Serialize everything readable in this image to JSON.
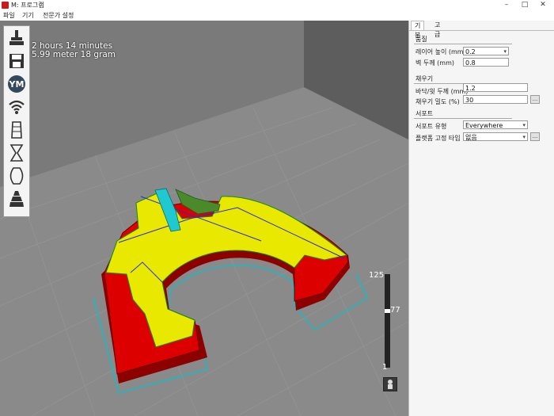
{
  "window": {
    "title": "M: 프로그램",
    "min_glyph": "–",
    "max_glyph": "□",
    "close_glyph": "✕"
  },
  "menu": [
    {
      "label": "파일"
    },
    {
      "label": "기기"
    },
    {
      "label": "전문가 설정"
    }
  ],
  "viewport": {
    "print_time": "2 hours 14 minutes",
    "print_material": "5.99 meter 18 gram",
    "layer_max": "125",
    "layer_current": "77",
    "layer_min": "1",
    "current_layer_fraction": 0.61,
    "colors": {
      "background": "#6f6f6f",
      "wall": "#e00000",
      "infill": "#e8e800",
      "travel": "#2a2ad0",
      "skirt": "#20b8c0",
      "support": "#20c8d0"
    },
    "toolbar_icons": [
      "print-icon",
      "save-icon",
      "ym-icon",
      "wifi-icon",
      "shape-normal-icon",
      "shape-hourglass-icon",
      "shape-bulge-icon",
      "shape-pagoda-icon"
    ],
    "toolbar_ym": "YM"
  },
  "panel": {
    "tabs": [
      {
        "label": "기본"
      },
      {
        "label": "고급"
      }
    ],
    "quality": {
      "title": "품질",
      "layer_height_label": "레이어 높이 (mm)",
      "layer_height_value": "0.2",
      "shell_thickness_label": "벽 두께 (mm)",
      "shell_thickness_value": "0.8"
    },
    "fill": {
      "title": "채우기",
      "bottom_top_label": "바닥/윗 두께 (mm)",
      "bottom_top_value": "1.2",
      "density_label": "채우기 밀도 (%)",
      "density_value": "30",
      "button_glyph": "..."
    },
    "support": {
      "title": "서포트",
      "support_type_label": "서포트 유형",
      "support_type_value": "Everywhere",
      "adhesion_label": "플랫폼 고정 타입",
      "adhesion_value": "없음",
      "button_glyph": "..."
    }
  }
}
